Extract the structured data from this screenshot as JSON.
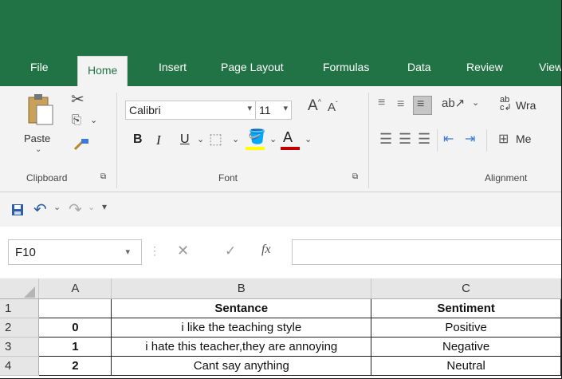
{
  "tabs": [
    "File",
    "Home",
    "Insert",
    "Page Layout",
    "Formulas",
    "Data",
    "Review",
    "View"
  ],
  "clipboard": {
    "paste_label": "Paste",
    "group_label": "Clipboard"
  },
  "font": {
    "name": "Calibri",
    "size": "11",
    "group_label": "Font",
    "bold": "B",
    "italic": "I",
    "underline": "U",
    "grow": "A",
    "shrink": "A",
    "color_letter": "A"
  },
  "alignment": {
    "group_label": "Alignment",
    "wrap_label": "Wra",
    "merge_label": "Me"
  },
  "formula_bar": {
    "name_box": "F10",
    "fx": "fx",
    "value": ""
  },
  "grid": {
    "column_headers": [
      "A",
      "B",
      "C"
    ],
    "rows": [
      {
        "num": "1",
        "a": "",
        "b": "Sentance",
        "c": "Sentiment"
      },
      {
        "num": "2",
        "a": "0",
        "b": "i like the teaching style",
        "c": "Positive"
      },
      {
        "num": "3",
        "a": "1",
        "b": "i hate this teacher,they are annoying",
        "c": "Negative"
      },
      {
        "num": "4",
        "a": "2",
        "b": "Cant say anything",
        "c": "Neutral"
      }
    ]
  },
  "colors": {
    "accent": "#217346",
    "font_color_bar": "#c00000",
    "highlight_bar": "#ffff00"
  }
}
